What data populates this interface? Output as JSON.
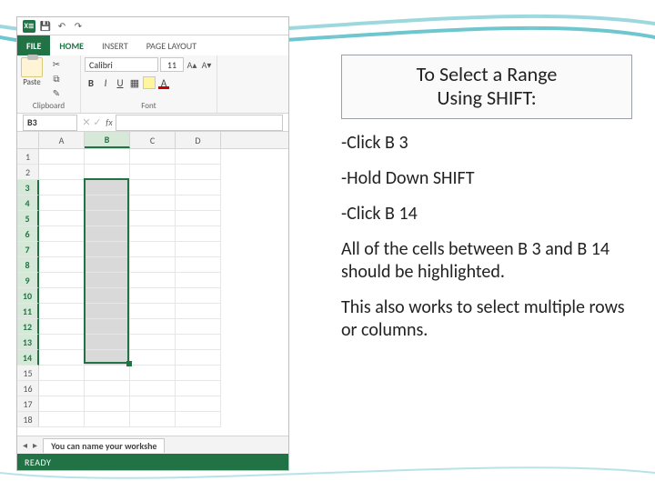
{
  "quick_access": {
    "app_badge": "X≣"
  },
  "tabs": {
    "file": "FILE",
    "home": "HOME",
    "insert": "INSERT",
    "page_layout": "PAGE LAYOUT"
  },
  "ribbon": {
    "clipboard": {
      "paste": "Paste",
      "label": "Clipboard"
    },
    "font": {
      "name": "Calibri",
      "size": "11",
      "label": "Font",
      "bold": "B",
      "italic": "I",
      "underline": "U"
    }
  },
  "namebox": "B3",
  "fx_label": "fx",
  "columns": [
    "A",
    "B",
    "C",
    "D"
  ],
  "rows": [
    "1",
    "2",
    "3",
    "4",
    "5",
    "6",
    "7",
    "8",
    "9",
    "10",
    "11",
    "12",
    "13",
    "14",
    "15",
    "16",
    "17",
    "18"
  ],
  "selected_rows": [
    3,
    4,
    5,
    6,
    7,
    8,
    9,
    10,
    11,
    12,
    13,
    14
  ],
  "selected_col": "B",
  "sheet_tab": "You can name your workshe",
  "status": "READY",
  "instructions": {
    "title_l1": "To Select a Range",
    "title_l2": "Using SHIFT:",
    "p1": "-Click B 3",
    "p2": "-Hold Down SHIFT",
    "p3": "-Click B 14",
    "p4": "All of the cells between B 3 and B 14 should be highlighted.",
    "p5": "This also works to select multiple rows or columns."
  }
}
